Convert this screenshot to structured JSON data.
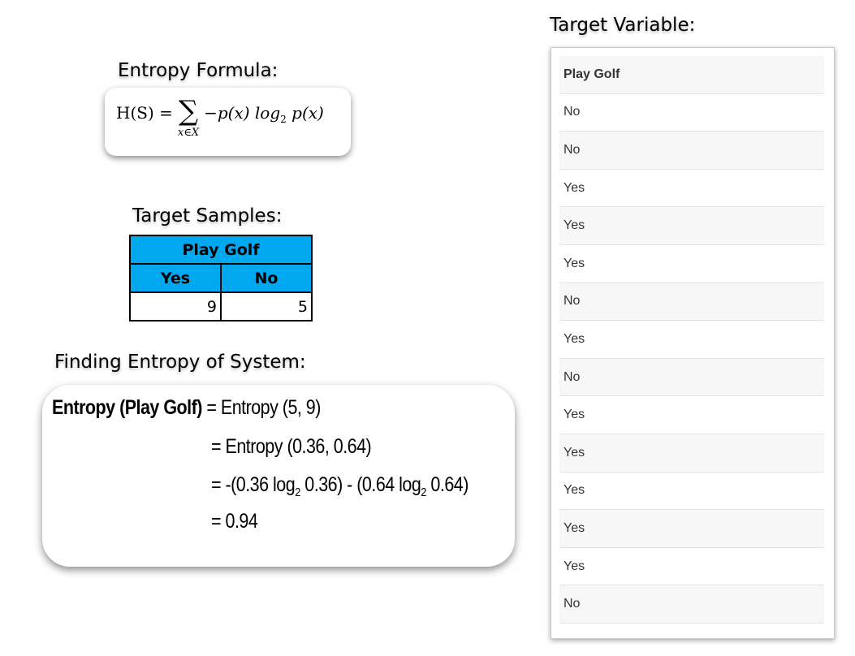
{
  "headings": {
    "formula": "Entropy Formula:",
    "samples": "Target Samples:",
    "system": "Finding Entropy of System:",
    "variable": "Target Variable:"
  },
  "formula": {
    "lhs": "H(S) =",
    "sigma": "∑",
    "sum_sub": "x∈X",
    "body": "−p(x) log",
    "log_base": "2",
    "tail": " p(x)"
  },
  "samples_table": {
    "title": "Play Golf",
    "columns": [
      "Yes",
      "No"
    ],
    "values": [
      "9",
      "5"
    ]
  },
  "entropy_calc": {
    "label": "Entropy (Play Golf)",
    "line1": " = Entropy (5, 9)",
    "line2": "= Entropy (0.36, 0.64)",
    "line3_a": "= -(0.36 log",
    "line3_sub1": "2",
    "line3_b": " 0.36) - (0.64 log",
    "line3_sub2": "2",
    "line3_c": " 0.64)",
    "line4": "= 0.94"
  },
  "target_variable": {
    "header": "Play Golf",
    "values": [
      "No",
      "No",
      "Yes",
      "Yes",
      "Yes",
      "No",
      "Yes",
      "No",
      "Yes",
      "Yes",
      "Yes",
      "Yes",
      "Yes",
      "No"
    ]
  }
}
